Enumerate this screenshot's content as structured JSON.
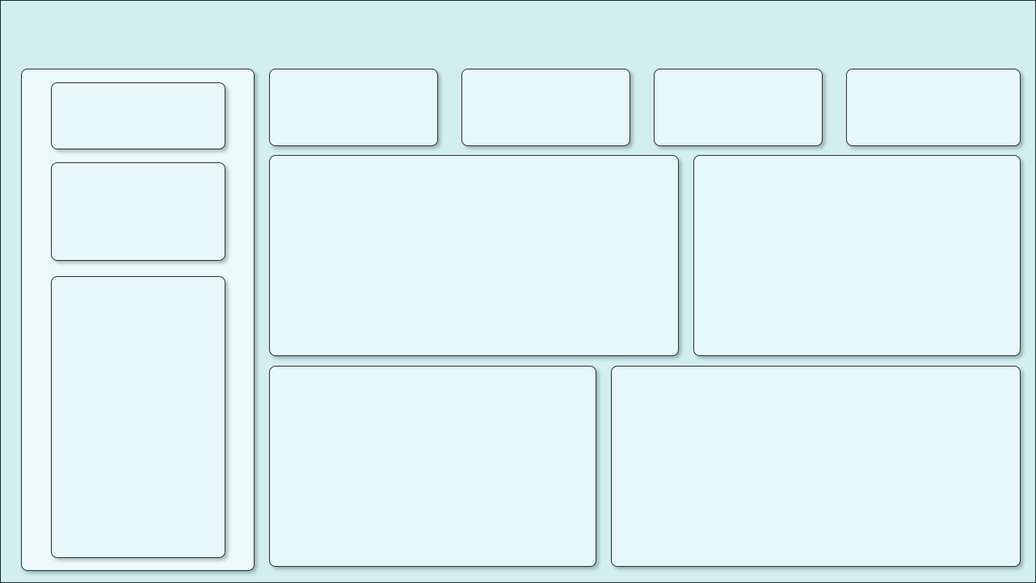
{
  "dashboard": {
    "header": {
      "title": ""
    },
    "sidebar": {
      "cards": [
        {
          "label": ""
        },
        {
          "label": ""
        },
        {
          "label": ""
        }
      ]
    },
    "kpis": [
      {
        "label": ""
      },
      {
        "label": ""
      },
      {
        "label": ""
      },
      {
        "label": ""
      }
    ],
    "panels": [
      {
        "label": ""
      },
      {
        "label": ""
      },
      {
        "label": ""
      },
      {
        "label": ""
      }
    ]
  },
  "colors": {
    "background": "#d2eeee",
    "panel": "#e8f7f7",
    "sidebar": "#eef9f9",
    "border": "#2b3333"
  }
}
